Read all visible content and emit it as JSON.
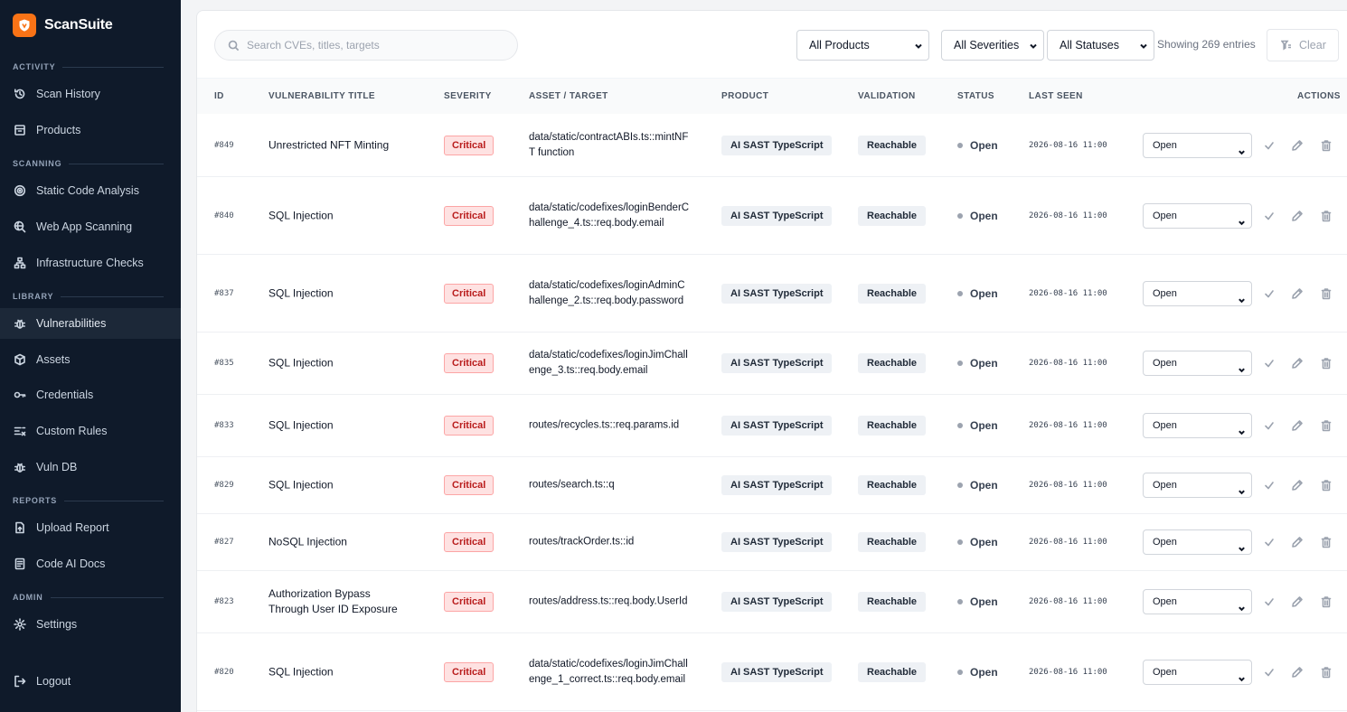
{
  "app": {
    "name": "ScanSuite"
  },
  "sidebar": {
    "sections": [
      {
        "label": "ACTIVITY",
        "items": [
          {
            "label": "Scan History",
            "icon": "history-icon"
          },
          {
            "label": "Products",
            "icon": "box-icon"
          }
        ]
      },
      {
        "label": "SCANNING",
        "items": [
          {
            "label": "Static Code Analysis",
            "icon": "target-icon"
          },
          {
            "label": "Web App Scanning",
            "icon": "search-globe-icon"
          },
          {
            "label": "Infrastructure Checks",
            "icon": "network-icon"
          }
        ]
      },
      {
        "label": "LIBRARY",
        "items": [
          {
            "label": "Vulnerabilities",
            "icon": "bug-icon"
          },
          {
            "label": "Assets",
            "icon": "cube-icon"
          },
          {
            "label": "Credentials",
            "icon": "key-icon"
          },
          {
            "label": "Custom Rules",
            "icon": "rules-icon"
          },
          {
            "label": "Vuln DB",
            "icon": "bug-icon"
          }
        ]
      },
      {
        "label": "REPORTS",
        "items": [
          {
            "label": "Upload Report",
            "icon": "upload-file-icon"
          },
          {
            "label": "Code AI Docs",
            "icon": "document-icon"
          }
        ]
      },
      {
        "label": "ADMIN",
        "items": [
          {
            "label": "Settings",
            "icon": "gear-icon"
          }
        ]
      }
    ],
    "logout_label": "Logout",
    "active_item": "Vulnerabilities"
  },
  "toolbar": {
    "search_placeholder": "Search CVEs, titles, targets",
    "product_filter": "All Products",
    "severity_filter": "All Severities",
    "status_filter": "All Statuses",
    "showing_text": "Showing 269 entries",
    "clear_label": "Clear"
  },
  "table": {
    "columns": [
      "ID",
      "VULNERABILITY TITLE",
      "SEVERITY",
      "ASSET / TARGET",
      "PRODUCT",
      "VALIDATION",
      "STATUS",
      "LAST SEEN",
      "ACTIONS"
    ],
    "rows": [
      {
        "id": "#849",
        "title": "Unrestricted NFT Minting",
        "severity": "Critical",
        "asset": "data/static/contractABIs.ts::mintNFT function",
        "product": "AI SAST TypeScript",
        "validation": "Reachable",
        "status": "Open",
        "last_seen": "2026-08-16 11:00",
        "status_select": "Open"
      },
      {
        "id": "#840",
        "title": "SQL Injection",
        "severity": "Critical",
        "asset": "data/static/codefixes/loginBenderChallenge_4.ts::req.body.email",
        "product": "AI SAST TypeScript",
        "validation": "Reachable",
        "status": "Open",
        "last_seen": "2026-08-16 11:00",
        "status_select": "Open"
      },
      {
        "id": "#837",
        "title": "SQL Injection",
        "severity": "Critical",
        "asset": "data/static/codefixes/loginAdminChallenge_2.ts::req.body.password",
        "product": "AI SAST TypeScript",
        "validation": "Reachable",
        "status": "Open",
        "last_seen": "2026-08-16 11:00",
        "status_select": "Open"
      },
      {
        "id": "#835",
        "title": "SQL Injection",
        "severity": "Critical",
        "asset": "data/static/codefixes/loginJimChallenge_3.ts::req.body.email",
        "product": "AI SAST TypeScript",
        "validation": "Reachable",
        "status": "Open",
        "last_seen": "2026-08-16 11:00",
        "status_select": "Open"
      },
      {
        "id": "#833",
        "title": "SQL Injection",
        "severity": "Critical",
        "asset": "routes/recycles.ts::req.params.id",
        "product": "AI SAST TypeScript",
        "validation": "Reachable",
        "status": "Open",
        "last_seen": "2026-08-16 11:00",
        "status_select": "Open"
      },
      {
        "id": "#829",
        "title": "SQL Injection",
        "severity": "Critical",
        "asset": "routes/search.ts::q",
        "product": "AI SAST TypeScript",
        "validation": "Reachable",
        "status": "Open",
        "last_seen": "2026-08-16 11:00",
        "status_select": "Open"
      },
      {
        "id": "#827",
        "title": "NoSQL Injection",
        "severity": "Critical",
        "asset": "routes/trackOrder.ts::id",
        "product": "AI SAST TypeScript",
        "validation": "Reachable",
        "status": "Open",
        "last_seen": "2026-08-16 11:00",
        "status_select": "Open"
      },
      {
        "id": "#823",
        "title": "Authorization Bypass Through User ID Exposure",
        "severity": "Critical",
        "asset": "routes/address.ts::req.body.UserId",
        "product": "AI SAST TypeScript",
        "validation": "Reachable",
        "status": "Open",
        "last_seen": "2026-08-16 11:00",
        "status_select": "Open"
      },
      {
        "id": "#820",
        "title": "SQL Injection",
        "severity": "Critical",
        "asset": "data/static/codefixes/loginJimChallenge_1_correct.ts::req.body.email",
        "product": "AI SAST TypeScript",
        "validation": "Reachable",
        "status": "Open",
        "last_seen": "2026-08-16 11:00",
        "status_select": "Open"
      }
    ]
  }
}
